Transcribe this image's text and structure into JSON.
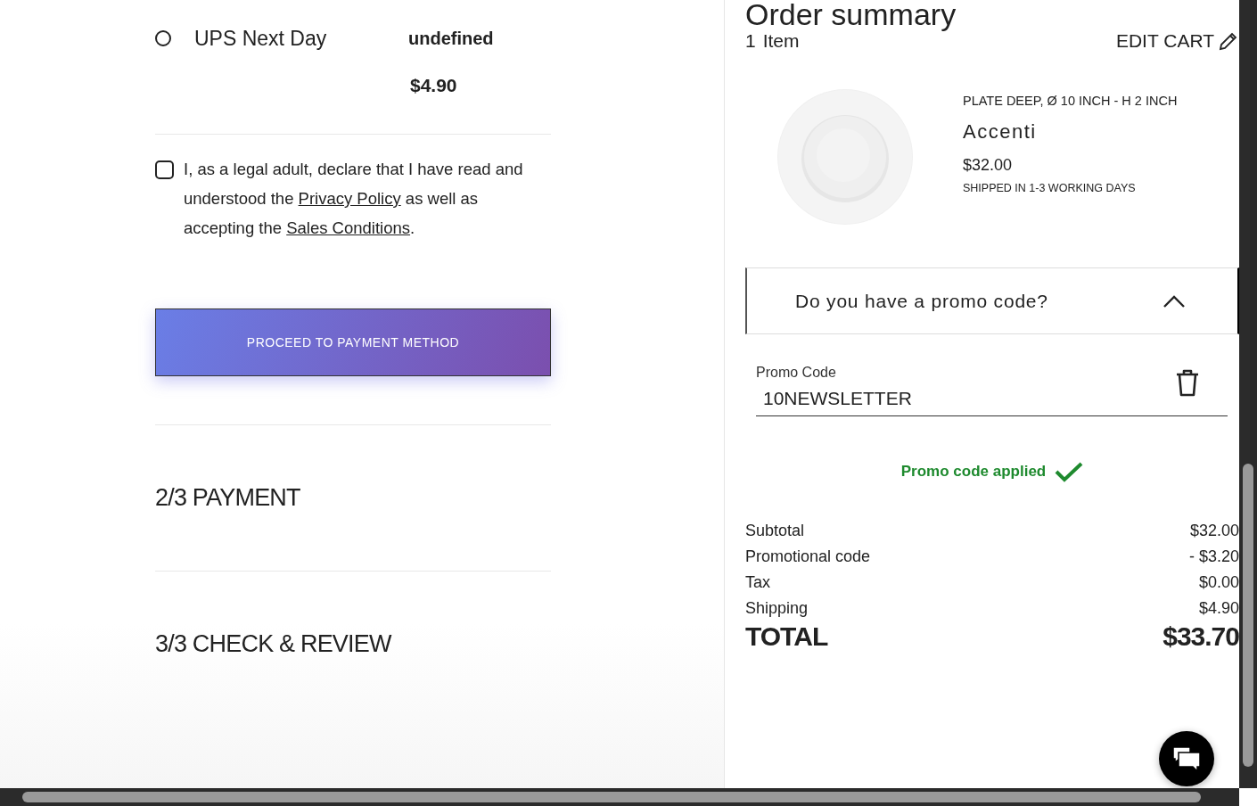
{
  "shipping": {
    "option": {
      "label": "UPS Next Day",
      "selected": false,
      "eta": "undefined",
      "price": "$4.90"
    }
  },
  "consent": {
    "checked": false,
    "parts": [
      {
        "kind": "text",
        "text": "I, as a legal adult, declare that I have read and understood the "
      },
      {
        "kind": "link",
        "text": "Privacy Policy"
      },
      {
        "kind": "text",
        "text": " as well as accepting the "
      },
      {
        "kind": "link",
        "text": "Sales Conditions"
      },
      {
        "kind": "text",
        "text": "."
      }
    ]
  },
  "proceed_button": "PROCEED TO PAYMENT METHOD",
  "steps": [
    "2/3 PAYMENT",
    "3/3 CHECK & REVIEW"
  ],
  "order_summary": {
    "title": "Order summary",
    "count_num": "1",
    "count_label": "Item",
    "edit_cart": "EDIT CART",
    "product": {
      "kind": "picture",
      "description": "PLATE DEEP, Ø 10 INCH - H 2 INCH",
      "name": "Accenti",
      "price": "$32.00",
      "shipping_note": "SHIPPED IN 1-3 WORKING DAYS"
    },
    "promo": {
      "question": "Do you have a promo code?",
      "expanded": true,
      "label": "Promo Code",
      "value": "10NEWSLETTER",
      "status": "Promo code applied"
    },
    "lines": [
      {
        "label": "Subtotal",
        "value": "$32.00"
      },
      {
        "label": "Promotional code",
        "value": "- $3.20"
      },
      {
        "label": "Tax",
        "value": "$0.00"
      },
      {
        "label": "Shipping",
        "value": "$4.90"
      }
    ],
    "total": {
      "label": "TOTAL",
      "value": "$33.70"
    }
  }
}
